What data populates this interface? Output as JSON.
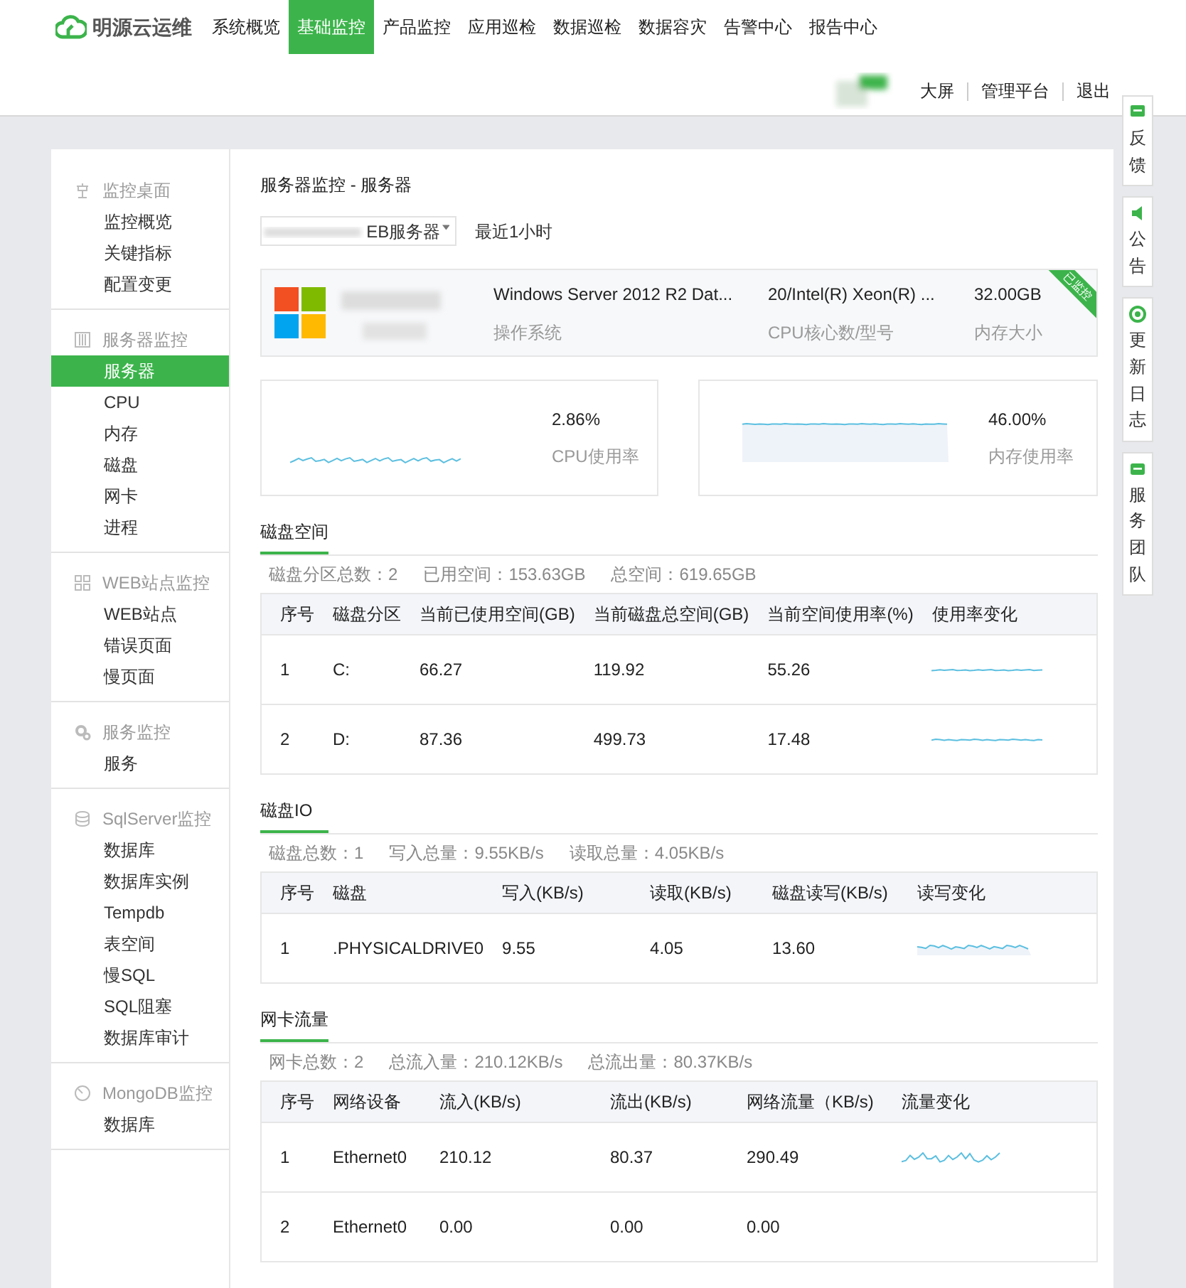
{
  "app": {
    "logo": "明源云运维"
  },
  "nav": [
    {
      "label": "系统概览",
      "selected": false
    },
    {
      "label": "基础监控",
      "selected": true
    },
    {
      "label": "产品监控",
      "selected": false
    },
    {
      "label": "应用巡检",
      "selected": false
    },
    {
      "label": "数据巡检",
      "selected": false
    },
    {
      "label": "数据容灾",
      "selected": false
    },
    {
      "label": "告警中心",
      "selected": false
    },
    {
      "label": "报告中心",
      "selected": false
    }
  ],
  "user_links": [
    "大屏",
    "管理平台",
    "退出"
  ],
  "side_tabs": [
    {
      "label": "反馈",
      "kind": "chat"
    },
    {
      "label": "公告",
      "kind": "speaker"
    },
    {
      "label": "更新日志",
      "kind": "refresh"
    },
    {
      "label": "服务团队",
      "kind": "team"
    }
  ],
  "sidebar": [
    {
      "title": "监控桌面",
      "kind": "desk",
      "children": [
        {
          "label": "监控概览",
          "selected": false
        },
        {
          "label": "关键指标",
          "selected": false
        },
        {
          "label": "配置变更",
          "selected": false
        }
      ]
    },
    {
      "title": "服务器监控",
      "kind": "server",
      "children": [
        {
          "label": "服务器",
          "selected": true
        },
        {
          "label": "CPU",
          "selected": false
        },
        {
          "label": "内存",
          "selected": false
        },
        {
          "label": "磁盘",
          "selected": false
        },
        {
          "label": "网卡",
          "selected": false
        },
        {
          "label": "进程",
          "selected": false
        }
      ]
    },
    {
      "title": "WEB站点监控",
      "kind": "web",
      "children": [
        {
          "label": "WEB站点",
          "selected": false
        },
        {
          "label": "错误页面",
          "selected": false
        },
        {
          "label": "慢页面",
          "selected": false
        }
      ]
    },
    {
      "title": "服务监控",
      "kind": "gear",
      "children": [
        {
          "label": "服务",
          "selected": false
        }
      ]
    },
    {
      "title": "SqlServer监控",
      "kind": "db",
      "children": [
        {
          "label": "数据库",
          "selected": false
        },
        {
          "label": "数据库实例",
          "selected": false
        },
        {
          "label": "Tempdb",
          "selected": false
        },
        {
          "label": "表空间",
          "selected": false
        },
        {
          "label": "慢SQL",
          "selected": false
        },
        {
          "label": "SQL阻塞",
          "selected": false
        },
        {
          "label": "数据库审计",
          "selected": false
        }
      ]
    },
    {
      "title": "MongoDB监控",
      "kind": "gauge",
      "children": [
        {
          "label": "数据库",
          "selected": false
        }
      ]
    }
  ],
  "breadcrumb": "服务器监控 - 服务器",
  "server_select": {
    "value": "EB服务器"
  },
  "time_range": "最近1小时",
  "server_info": {
    "badge": "已监控",
    "fields": [
      {
        "value": "Windows Server 2012 R2 Dat...",
        "label": "操作系统"
      },
      {
        "value": "20/Intel(R) Xeon(R) ...",
        "label": "CPU核心数/型号"
      },
      {
        "value": "32.00GB",
        "label": "内存大小"
      }
    ]
  },
  "gauges": [
    {
      "value": "2.86%",
      "label": "CPU使用率",
      "kind": "line"
    },
    {
      "value": "46.00%",
      "label": "内存使用率",
      "kind": "area"
    }
  ],
  "sections": [
    {
      "title": "磁盘空间",
      "summary": [
        "磁盘分区总数：2",
        "已用空间：153.63GB",
        "总空间：619.65GB"
      ],
      "columns": [
        "序号",
        "磁盘分区",
        "当前已使用空间(GB)",
        "当前磁盘总空间(GB)",
        "当前空间使用率(%)",
        "使用率变化"
      ],
      "rows": [
        {
          "cells": [
            "1",
            "C:",
            "66.27",
            "119.92",
            "55.26"
          ],
          "sparkline": true
        },
        {
          "cells": [
            "2",
            "D:",
            "87.36",
            "499.73",
            "17.48"
          ],
          "sparkline": true
        }
      ]
    },
    {
      "title": "磁盘IO",
      "summary": [
        "磁盘总数：1",
        "写入总量：9.55KB/s",
        "读取总量：4.05KB/s"
      ],
      "columns": [
        "序号",
        "磁盘",
        "写入(KB/s)",
        "读取(KB/s)",
        "磁盘读写(KB/s)",
        "读写变化"
      ],
      "rows": [
        {
          "cells": [
            "1",
            ".PHYSICALDRIVE0",
            "9.55",
            "4.05",
            "13.60"
          ],
          "sparkline": true
        }
      ]
    },
    {
      "title": "网卡流量",
      "summary": [
        "网卡总数：2",
        "总流入量：210.12KB/s",
        "总流出量：80.37KB/s"
      ],
      "columns": [
        "序号",
        "网络设备",
        "流入(KB/s)",
        "流出(KB/s)",
        "网络流量（KB/s)",
        "流量变化"
      ],
      "rows": [
        {
          "cells": [
            "1",
            "Ethernet0",
            "210.12",
            "80.37",
            "290.49"
          ],
          "sparkline": true
        },
        {
          "cells": [
            "2",
            "Ethernet0",
            "0.00",
            "0.00",
            "0.00"
          ],
          "sparkline": false
        }
      ]
    }
  ]
}
